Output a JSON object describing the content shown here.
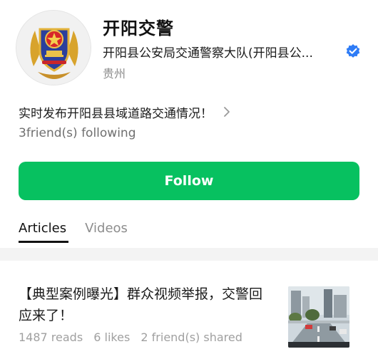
{
  "profile": {
    "name": "开阳交警",
    "organization": "开阳县公安局交通警察大队(开阳县公...",
    "region": "贵州",
    "bio": "实时发布开阳县县域道路交通情况！",
    "following": "3friend(s) following",
    "avatar_icon": "police-emblem-icon",
    "verified_icon": "verified-check-icon",
    "verified_color": "#2e7cf6"
  },
  "actions": {
    "follow_label": "Follow",
    "follow_color": "#07c160"
  },
  "tabs": [
    {
      "label": "Articles",
      "active": true
    },
    {
      "label": "Videos",
      "active": false
    }
  ],
  "articles": [
    {
      "title": "【典型案例曝光】群众视频举报，交警回应来了！",
      "reads": "1487 reads",
      "likes": "6 likes",
      "shared": "2 friend(s) shared",
      "thumbnail_icon": "street-scene-thumbnail"
    }
  ]
}
